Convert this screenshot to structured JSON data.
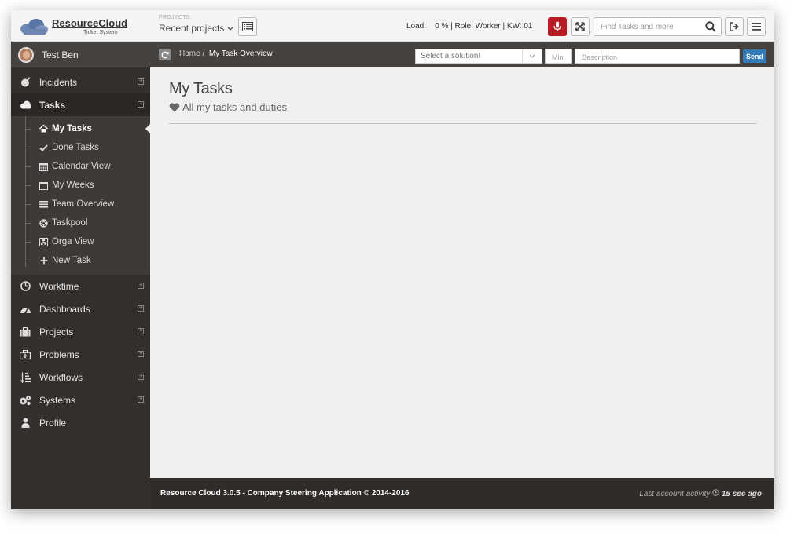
{
  "app": {
    "logo_name": "ResourceCloud",
    "logo_sub": "Ticket System"
  },
  "header": {
    "projects_caption": "PROJECTS:",
    "projects_selected": "Recent projects",
    "status_load_label": "Load:",
    "status_text": "0 % | Role: Worker | KW: 01",
    "search_placeholder": "Find Tasks and more",
    "mic_color": "#b71c24"
  },
  "sidebar": {
    "user_name": "Test Ben",
    "items": [
      {
        "label": "Incidents",
        "icon": "bomb-icon",
        "expand": "+"
      },
      {
        "label": "Tasks",
        "icon": "cloud-icon",
        "expand": "-"
      },
      {
        "label": "Worktime",
        "icon": "clock-icon",
        "expand": "+"
      },
      {
        "label": "Dashboards",
        "icon": "dashboard-icon",
        "expand": "+"
      },
      {
        "label": "Projects",
        "icon": "briefcase-icon",
        "expand": "+"
      },
      {
        "label": "Problems",
        "icon": "medkit-icon",
        "expand": "+"
      },
      {
        "label": "Workflows",
        "icon": "sort-icon",
        "expand": "+"
      },
      {
        "label": "Systems",
        "icon": "gears-icon",
        "expand": "+"
      },
      {
        "label": "Profile",
        "icon": "user-icon",
        "expand": ""
      }
    ],
    "tasks_submenu": [
      {
        "label": "My Tasks",
        "icon": "home-icon"
      },
      {
        "label": "Done Tasks",
        "icon": "check-icon"
      },
      {
        "label": "Calendar View",
        "icon": "calendar-icon"
      },
      {
        "label": "My Weeks",
        "icon": "calendar-empty-icon"
      },
      {
        "label": "Team Overview",
        "icon": "list-icon"
      },
      {
        "label": "Taskpool",
        "icon": "lifebuoy-icon"
      },
      {
        "label": "Orga View",
        "icon": "sitemap-icon"
      },
      {
        "label": "New Task",
        "icon": "plus-icon"
      }
    ]
  },
  "breadcrumb": {
    "home": "Home",
    "separator": "/",
    "current": "My Task Overview"
  },
  "quick_entry": {
    "solution_placeholder": "Select a solution!",
    "min_placeholder": "Min",
    "description_placeholder": "Description",
    "send_label": "Send",
    "send_color": "#337ab7"
  },
  "main": {
    "title": "My Tasks",
    "subtitle": "All my tasks and duties"
  },
  "footer": {
    "left": "Resource Cloud 3.0.5 - Company Steering Application © 2014-2016",
    "activity_label": "Last account activity",
    "activity_value": "15 sec ago"
  }
}
